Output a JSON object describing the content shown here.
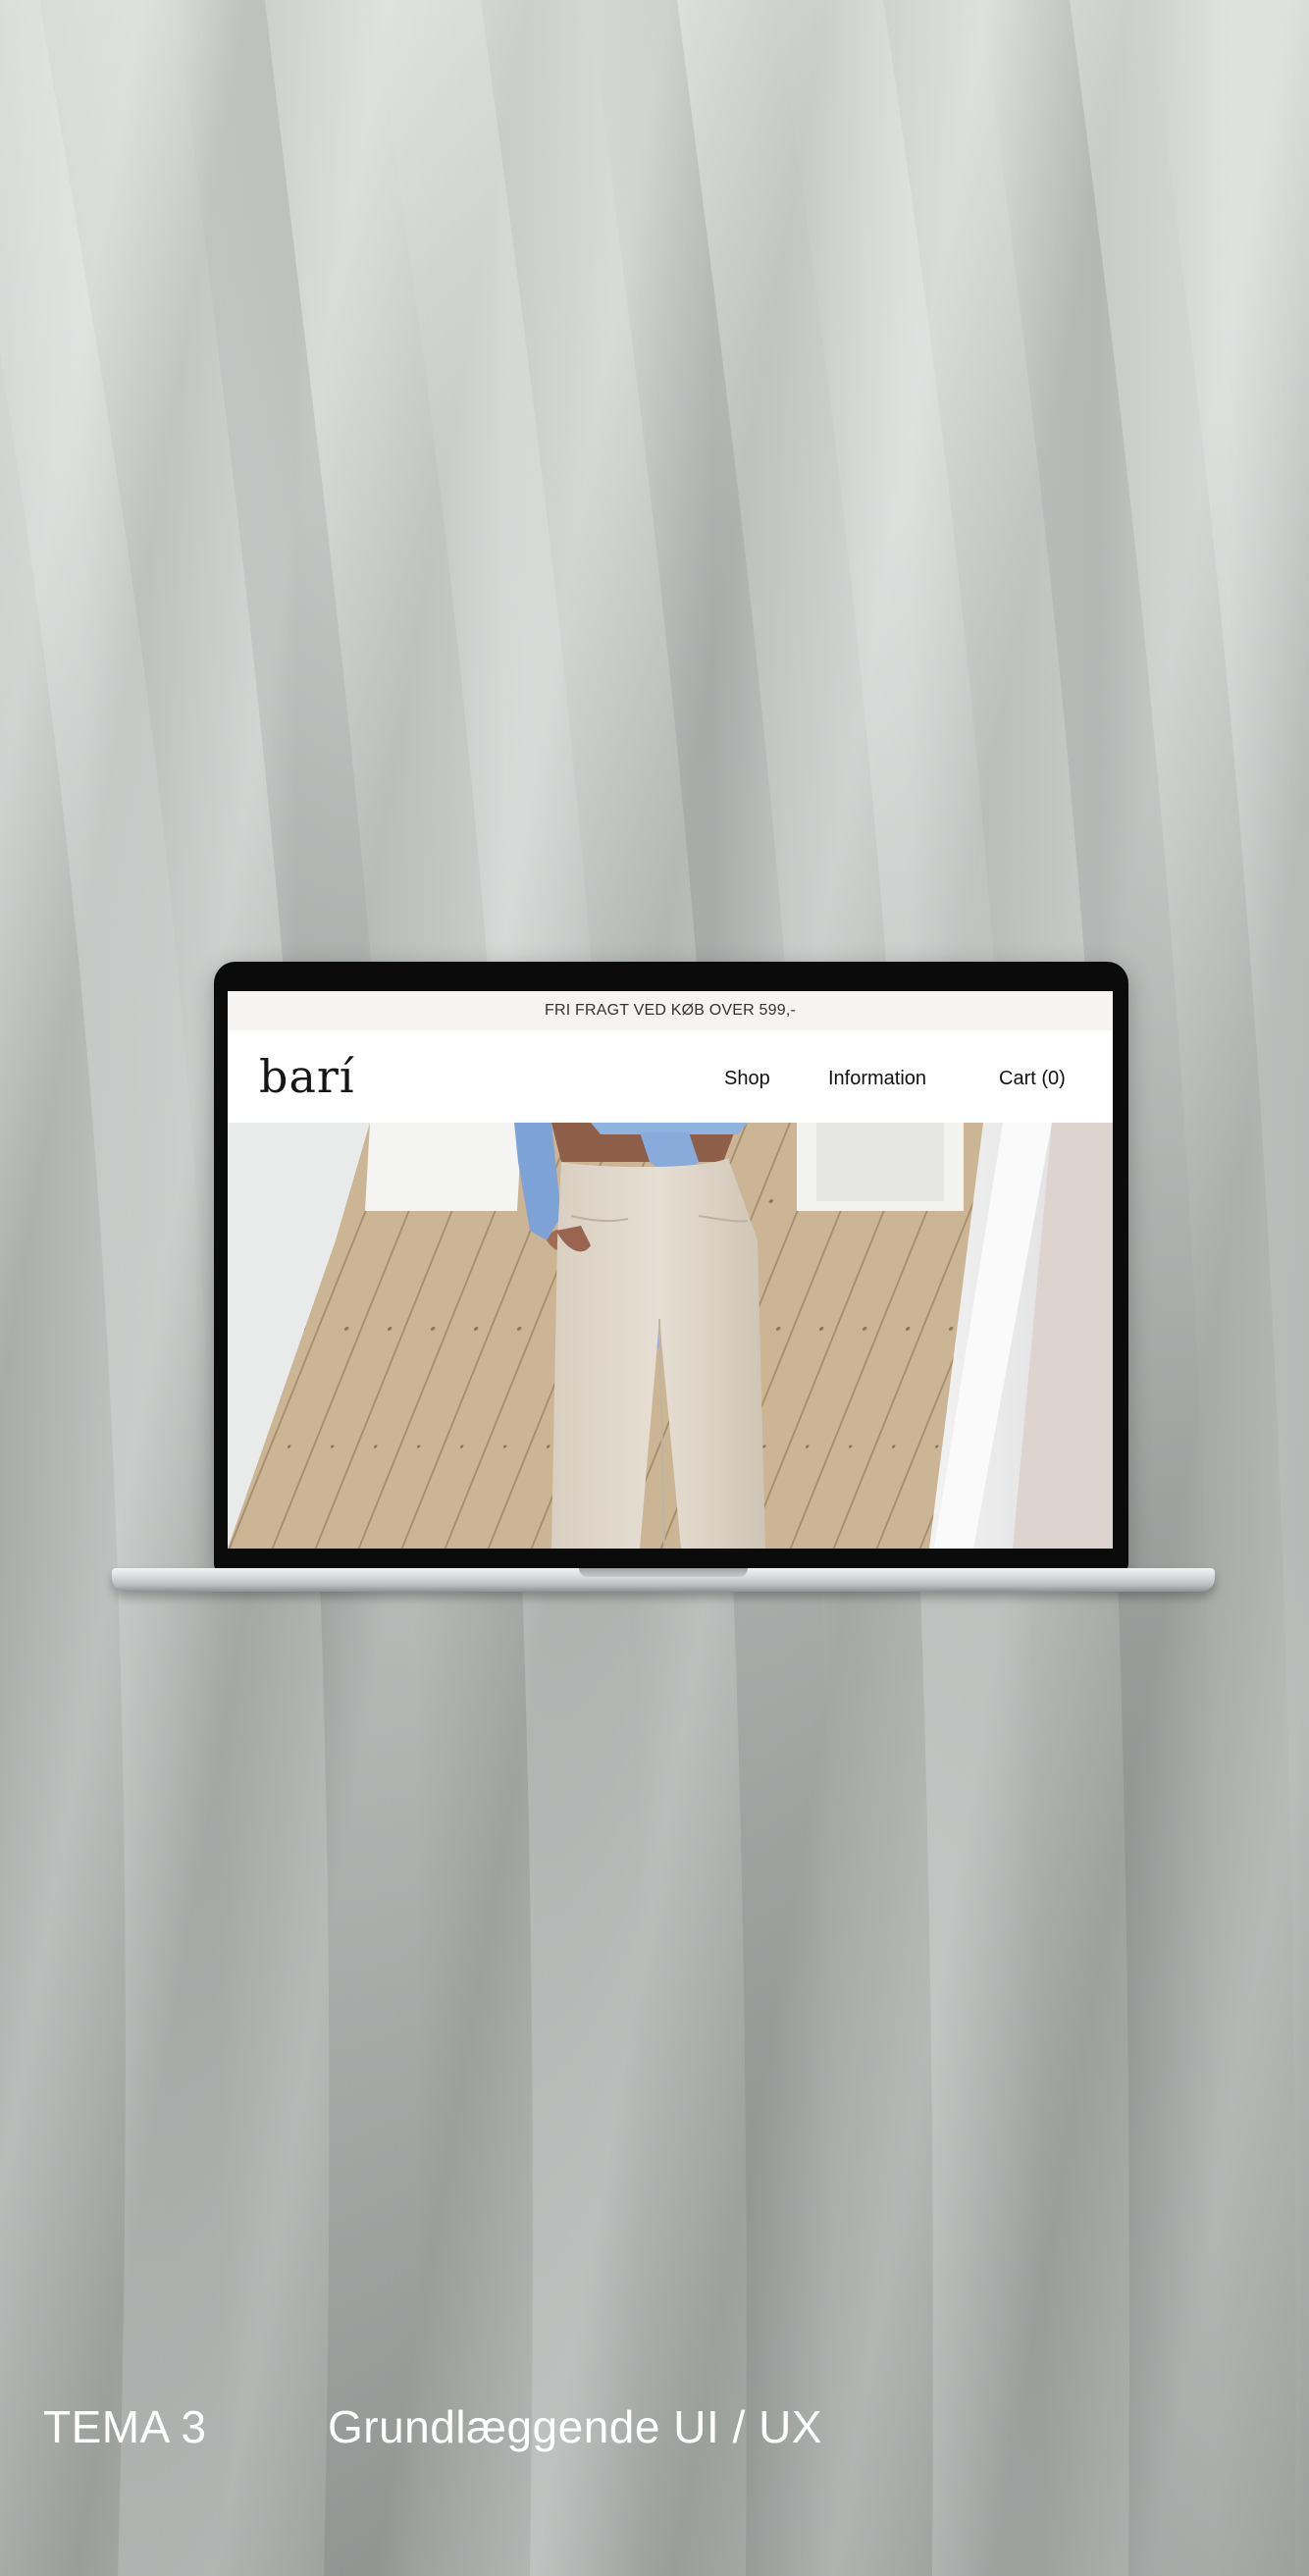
{
  "website": {
    "announcement": "FRI FRAGT VED KØB OVER 599,-",
    "logo": "barí",
    "nav": {
      "shop": "Shop",
      "information": "Information",
      "cart": "Cart (0)"
    }
  },
  "caption": {
    "theme": "TEMA 3",
    "subject": "Grundlæggende UI / UX"
  },
  "colors": {
    "background": "#a8adaa",
    "caption_text": "#ffffff",
    "announcement_bg": "#f5f4f2",
    "top_blue": "#8fb2de",
    "floor": "#cdb898"
  },
  "icons": {
    "hero": "hero-photo"
  }
}
